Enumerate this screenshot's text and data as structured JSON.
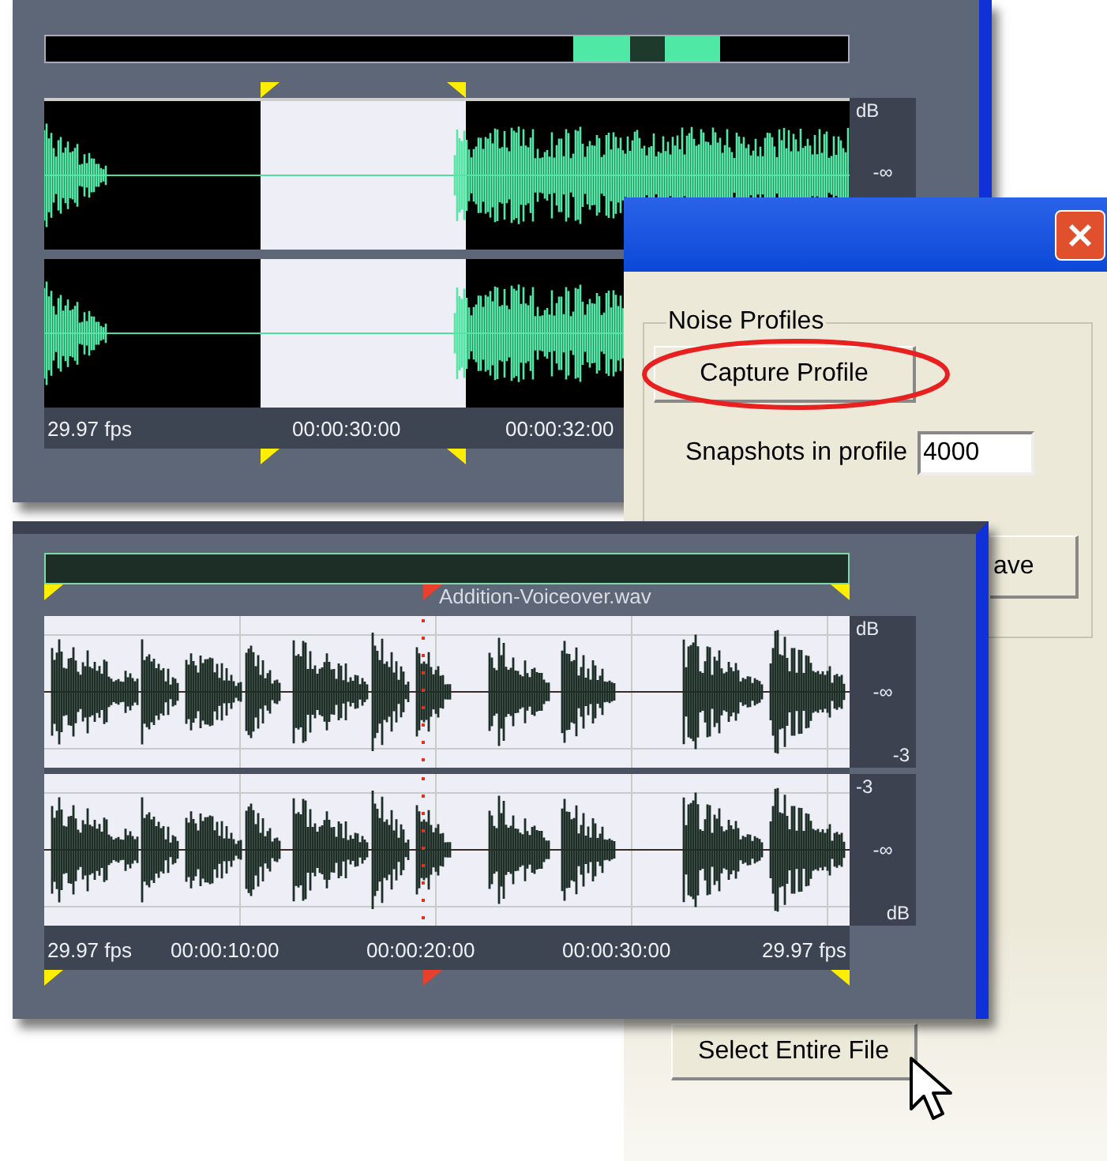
{
  "top_editor": {
    "db_ruler": [
      [
        "dB",
        "-∞"
      ]
    ],
    "time_ruler": [
      "29.97 fps",
      "00:00:30:00",
      "00:00:32:00"
    ]
  },
  "dialog": {
    "group_title": "Noise Profiles",
    "capture_button": {
      "label": "Capture Profile"
    },
    "snapshots": {
      "label": "Snapshots in profile",
      "value": "4000"
    },
    "partial_button": {
      "label": "ave"
    },
    "select_button": {
      "label": "Select Entire File"
    }
  },
  "bottom_editor": {
    "file_name": "Addition-Voiceover.wav",
    "db_ruler": [
      [
        "dB",
        "-∞",
        "-3"
      ],
      [
        "-3",
        "-∞",
        "dB"
      ]
    ],
    "time_ruler": [
      "29.97 fps",
      "00:00:10:00",
      "00:00:20:00",
      "00:00:30:00",
      "29.97 fps"
    ]
  }
}
